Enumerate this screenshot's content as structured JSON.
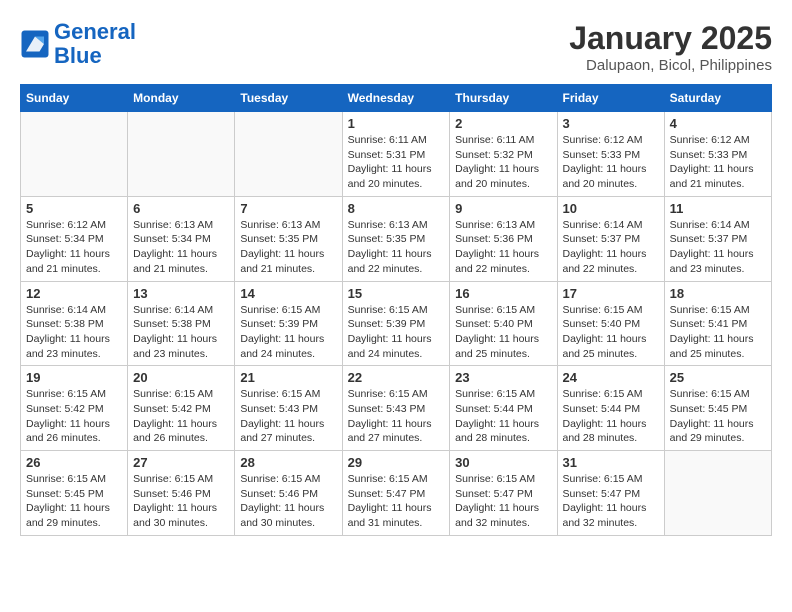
{
  "header": {
    "logo_line1": "General",
    "logo_line2": "Blue",
    "month": "January 2025",
    "location": "Dalupaon, Bicol, Philippines"
  },
  "weekdays": [
    "Sunday",
    "Monday",
    "Tuesday",
    "Wednesday",
    "Thursday",
    "Friday",
    "Saturday"
  ],
  "weeks": [
    [
      {
        "day": "",
        "info": ""
      },
      {
        "day": "",
        "info": ""
      },
      {
        "day": "",
        "info": ""
      },
      {
        "day": "1",
        "info": "Sunrise: 6:11 AM\nSunset: 5:31 PM\nDaylight: 11 hours\nand 20 minutes."
      },
      {
        "day": "2",
        "info": "Sunrise: 6:11 AM\nSunset: 5:32 PM\nDaylight: 11 hours\nand 20 minutes."
      },
      {
        "day": "3",
        "info": "Sunrise: 6:12 AM\nSunset: 5:33 PM\nDaylight: 11 hours\nand 20 minutes."
      },
      {
        "day": "4",
        "info": "Sunrise: 6:12 AM\nSunset: 5:33 PM\nDaylight: 11 hours\nand 21 minutes."
      }
    ],
    [
      {
        "day": "5",
        "info": "Sunrise: 6:12 AM\nSunset: 5:34 PM\nDaylight: 11 hours\nand 21 minutes."
      },
      {
        "day": "6",
        "info": "Sunrise: 6:13 AM\nSunset: 5:34 PM\nDaylight: 11 hours\nand 21 minutes."
      },
      {
        "day": "7",
        "info": "Sunrise: 6:13 AM\nSunset: 5:35 PM\nDaylight: 11 hours\nand 21 minutes."
      },
      {
        "day": "8",
        "info": "Sunrise: 6:13 AM\nSunset: 5:35 PM\nDaylight: 11 hours\nand 22 minutes."
      },
      {
        "day": "9",
        "info": "Sunrise: 6:13 AM\nSunset: 5:36 PM\nDaylight: 11 hours\nand 22 minutes."
      },
      {
        "day": "10",
        "info": "Sunrise: 6:14 AM\nSunset: 5:37 PM\nDaylight: 11 hours\nand 22 minutes."
      },
      {
        "day": "11",
        "info": "Sunrise: 6:14 AM\nSunset: 5:37 PM\nDaylight: 11 hours\nand 23 minutes."
      }
    ],
    [
      {
        "day": "12",
        "info": "Sunrise: 6:14 AM\nSunset: 5:38 PM\nDaylight: 11 hours\nand 23 minutes."
      },
      {
        "day": "13",
        "info": "Sunrise: 6:14 AM\nSunset: 5:38 PM\nDaylight: 11 hours\nand 23 minutes."
      },
      {
        "day": "14",
        "info": "Sunrise: 6:15 AM\nSunset: 5:39 PM\nDaylight: 11 hours\nand 24 minutes."
      },
      {
        "day": "15",
        "info": "Sunrise: 6:15 AM\nSunset: 5:39 PM\nDaylight: 11 hours\nand 24 minutes."
      },
      {
        "day": "16",
        "info": "Sunrise: 6:15 AM\nSunset: 5:40 PM\nDaylight: 11 hours\nand 25 minutes."
      },
      {
        "day": "17",
        "info": "Sunrise: 6:15 AM\nSunset: 5:40 PM\nDaylight: 11 hours\nand 25 minutes."
      },
      {
        "day": "18",
        "info": "Sunrise: 6:15 AM\nSunset: 5:41 PM\nDaylight: 11 hours\nand 25 minutes."
      }
    ],
    [
      {
        "day": "19",
        "info": "Sunrise: 6:15 AM\nSunset: 5:42 PM\nDaylight: 11 hours\nand 26 minutes."
      },
      {
        "day": "20",
        "info": "Sunrise: 6:15 AM\nSunset: 5:42 PM\nDaylight: 11 hours\nand 26 minutes."
      },
      {
        "day": "21",
        "info": "Sunrise: 6:15 AM\nSunset: 5:43 PM\nDaylight: 11 hours\nand 27 minutes."
      },
      {
        "day": "22",
        "info": "Sunrise: 6:15 AM\nSunset: 5:43 PM\nDaylight: 11 hours\nand 27 minutes."
      },
      {
        "day": "23",
        "info": "Sunrise: 6:15 AM\nSunset: 5:44 PM\nDaylight: 11 hours\nand 28 minutes."
      },
      {
        "day": "24",
        "info": "Sunrise: 6:15 AM\nSunset: 5:44 PM\nDaylight: 11 hours\nand 28 minutes."
      },
      {
        "day": "25",
        "info": "Sunrise: 6:15 AM\nSunset: 5:45 PM\nDaylight: 11 hours\nand 29 minutes."
      }
    ],
    [
      {
        "day": "26",
        "info": "Sunrise: 6:15 AM\nSunset: 5:45 PM\nDaylight: 11 hours\nand 29 minutes."
      },
      {
        "day": "27",
        "info": "Sunrise: 6:15 AM\nSunset: 5:46 PM\nDaylight: 11 hours\nand 30 minutes."
      },
      {
        "day": "28",
        "info": "Sunrise: 6:15 AM\nSunset: 5:46 PM\nDaylight: 11 hours\nand 30 minutes."
      },
      {
        "day": "29",
        "info": "Sunrise: 6:15 AM\nSunset: 5:47 PM\nDaylight: 11 hours\nand 31 minutes."
      },
      {
        "day": "30",
        "info": "Sunrise: 6:15 AM\nSunset: 5:47 PM\nDaylight: 11 hours\nand 32 minutes."
      },
      {
        "day": "31",
        "info": "Sunrise: 6:15 AM\nSunset: 5:47 PM\nDaylight: 11 hours\nand 32 minutes."
      },
      {
        "day": "",
        "info": ""
      }
    ]
  ]
}
